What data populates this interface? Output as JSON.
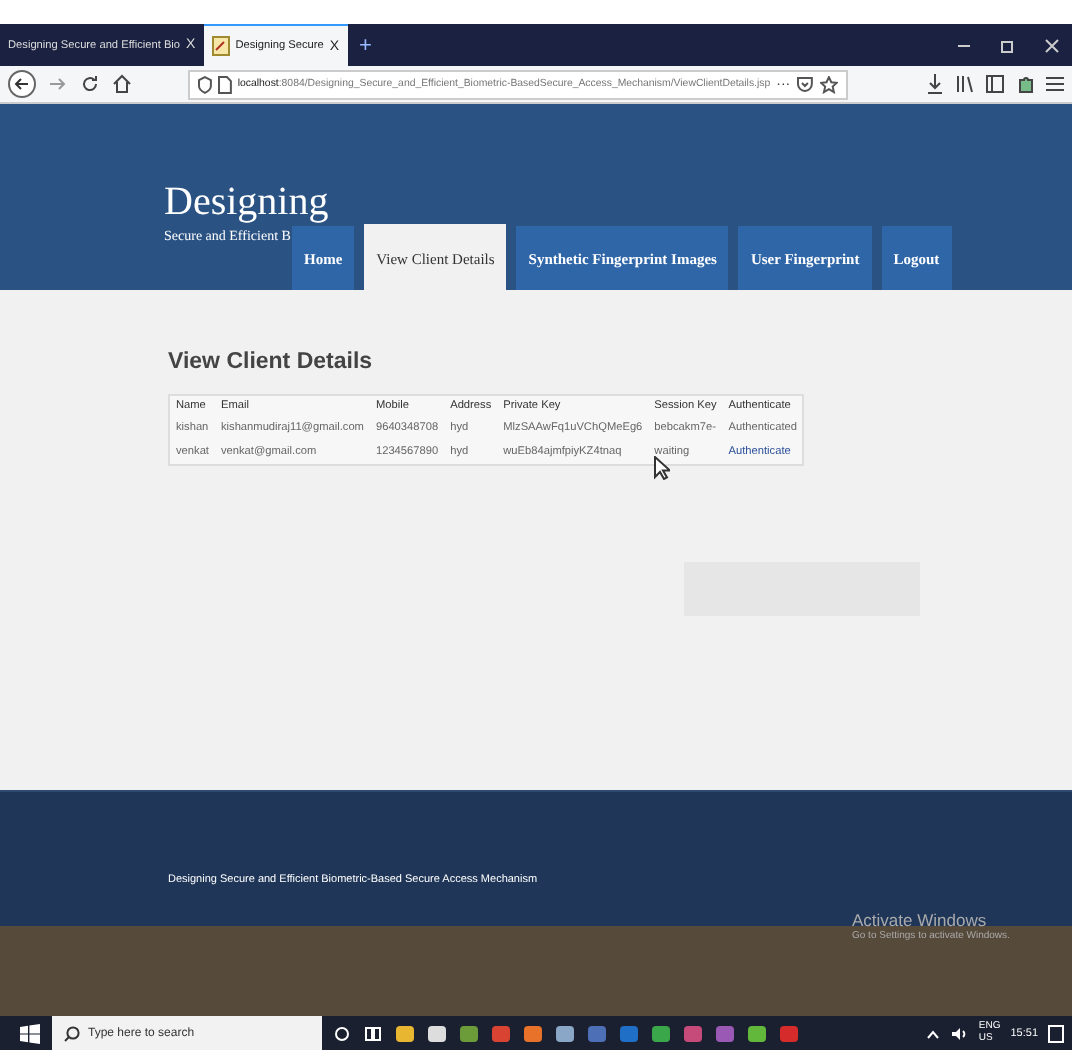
{
  "browser": {
    "tabs": [
      {
        "title": "Designing Secure and Efficient Bio",
        "close": "X",
        "selected": false
      },
      {
        "title": "Designing Secure",
        "close": "X",
        "selected": true
      }
    ],
    "new_tab": "+",
    "url_host": "localhost",
    "url_path": ":8084/Designing_Secure_and_Efficient_Biometric-BasedSecure_Access_Mechanism/ViewClientDetails.jsp",
    "more": "···"
  },
  "site": {
    "title": "Designing",
    "subtitle": "Secure and Efficient B",
    "nav": [
      {
        "label": "Home",
        "selected": false
      },
      {
        "label": "View Client Details",
        "selected": true
      },
      {
        "label": "Synthetic Fingerprint Images",
        "selected": false
      },
      {
        "label": "User Fingerprint",
        "selected": false
      },
      {
        "label": "Logout",
        "selected": false
      }
    ]
  },
  "content": {
    "heading": "View Client Details",
    "table": {
      "columns": [
        "Name",
        "Email",
        "Mobile",
        "Address",
        "Private Key",
        "Session Key",
        "Authenticate"
      ],
      "rows": [
        {
          "cells": [
            "kishan",
            "kishanmudiraj11@gmail.com",
            "9640348708",
            "hyd",
            "MlzSAAwFq1uVChQMeEg6",
            "bebcakm7e-"
          ],
          "authenticate": "Authenticated",
          "kind": "text"
        },
        {
          "cells": [
            "venkat",
            "venkat@gmail.com",
            "1234567890",
            "hyd",
            "wuEb84ajmfpiyKZ4tnaq",
            "waiting"
          ],
          "authenticate": "Authenticate",
          "kind": "link"
        }
      ]
    }
  },
  "footer": {
    "text": "Designing Secure and Efficient Biometric-Based Secure Access Mechanism"
  },
  "activation": {
    "title": "Activate Windows",
    "text": "Go to Settings to activate Windows."
  },
  "taskbar": {
    "search_placeholder": "Type here to search",
    "language": "ENG",
    "region": "US",
    "time": "15:51"
  }
}
